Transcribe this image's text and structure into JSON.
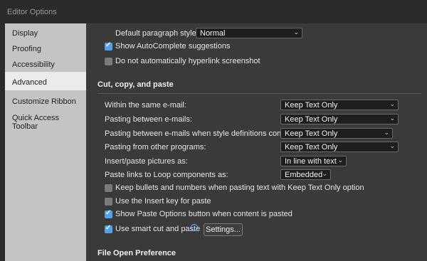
{
  "window": {
    "title": "Editor Options"
  },
  "sidebar": {
    "items": [
      {
        "label": "Display"
      },
      {
        "label": "Proofing"
      },
      {
        "label": "Accessibility"
      },
      {
        "label": "Advanced",
        "selected": true
      },
      {
        "label": "Customize Ribbon"
      },
      {
        "label": "Quick Access Toolbar"
      }
    ]
  },
  "top": {
    "default_paragraph_style": {
      "label": "Default paragraph style:",
      "value": "Normal"
    },
    "autocomplete": {
      "label": "Show AutoComplete suggestions",
      "checked": true
    },
    "no_hyperlink": {
      "label": "Do not automatically hyperlink screenshot",
      "checked": false
    }
  },
  "cut_copy_paste": {
    "heading": "Cut, copy, and paste",
    "rows": [
      {
        "label": "Within the same e-mail:",
        "value": "Keep Text Only"
      },
      {
        "label": "Pasting between e-mails:",
        "value": "Keep Text Only"
      },
      {
        "label": "Pasting between e-mails when style definitions conflict:",
        "value": "Keep Text Only"
      },
      {
        "label": "Pasting from other programs:",
        "value": "Keep Text Only"
      },
      {
        "label": "Insert/paste pictures as:",
        "value": "In line with text"
      },
      {
        "label": "Paste links to Loop components as:",
        "value": "Embedded"
      }
    ],
    "checks": [
      {
        "label": "Keep bullets and numbers when pasting text with Keep Text Only option",
        "checked": false
      },
      {
        "label": "Use the Insert key for paste",
        "checked": false
      },
      {
        "label": "Show Paste Options button when content is pasted",
        "checked": true
      },
      {
        "label": "Use smart cut and paste",
        "checked": true
      }
    ],
    "settings_button": "Settings..."
  },
  "file_open": {
    "heading": "File Open Preference"
  },
  "colors": {
    "accent": "#4da3ef",
    "sidebar_bg": "#c4c4c4",
    "main_bg": "#3a3a3a"
  }
}
